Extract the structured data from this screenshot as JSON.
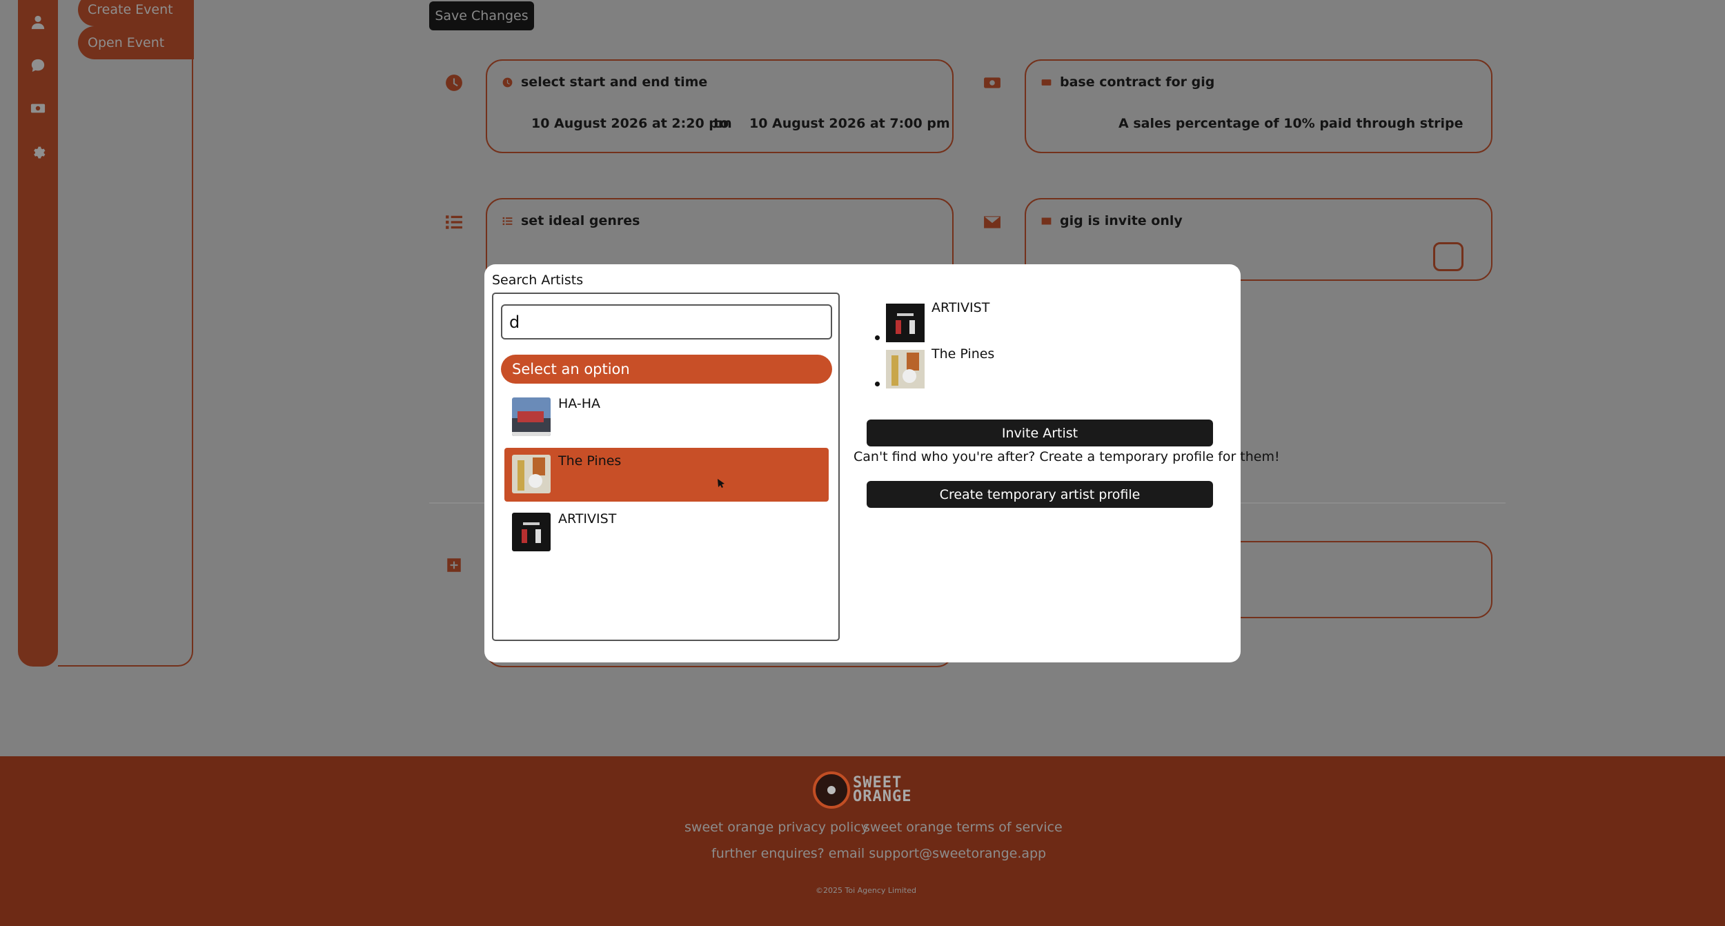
{
  "sidebar": {
    "icons": [
      "user-icon",
      "chat-icon",
      "money-icon",
      "gear-icon"
    ],
    "buttons": {
      "create_event": "Create Event",
      "open_event": "Open Event"
    }
  },
  "toolbar": {
    "save_label": "Save Changes"
  },
  "cards": {
    "time": {
      "title": "select start and end time",
      "start": "10 August 2026 at 2:20 pm",
      "separator": "to",
      "end": "10 August 2026 at 7:00 pm"
    },
    "contract": {
      "title": "base contract for gig",
      "value": "A sales percentage of 10% paid through stripe"
    },
    "genres": {
      "title": "set ideal genres"
    },
    "invite": {
      "title": "gig is invite only",
      "checked": false
    }
  },
  "modal": {
    "label": "Search Artists",
    "search": {
      "value": "d"
    },
    "select_placeholder": "Select an option",
    "options": [
      {
        "label": "HA-HA",
        "selected": false
      },
      {
        "label": "The Pines",
        "selected": true
      },
      {
        "label": "ARTIVIST",
        "selected": false
      }
    ],
    "invited": [
      {
        "label": "ARTIVIST"
      },
      {
        "label": "The Pines"
      }
    ],
    "invite_button": "Invite Artist",
    "hint": "Can't find who you're after? Create a temporary profile for them!",
    "create_button": "Create temporary artist profile"
  },
  "footer": {
    "logo_line1": "SWEET",
    "logo_line2": "ORANGE",
    "privacy": "sweet orange privacy policy",
    "terms": "sweet orange terms of service",
    "contact": "further enquires? email support@sweetorange.app",
    "copyright": "©2025 Toi Agency Limited"
  },
  "colors": {
    "accent": "#c84f27",
    "brand_dark": "#74311b",
    "footer_bg": "#6e2a15",
    "overlay": "#808080"
  }
}
